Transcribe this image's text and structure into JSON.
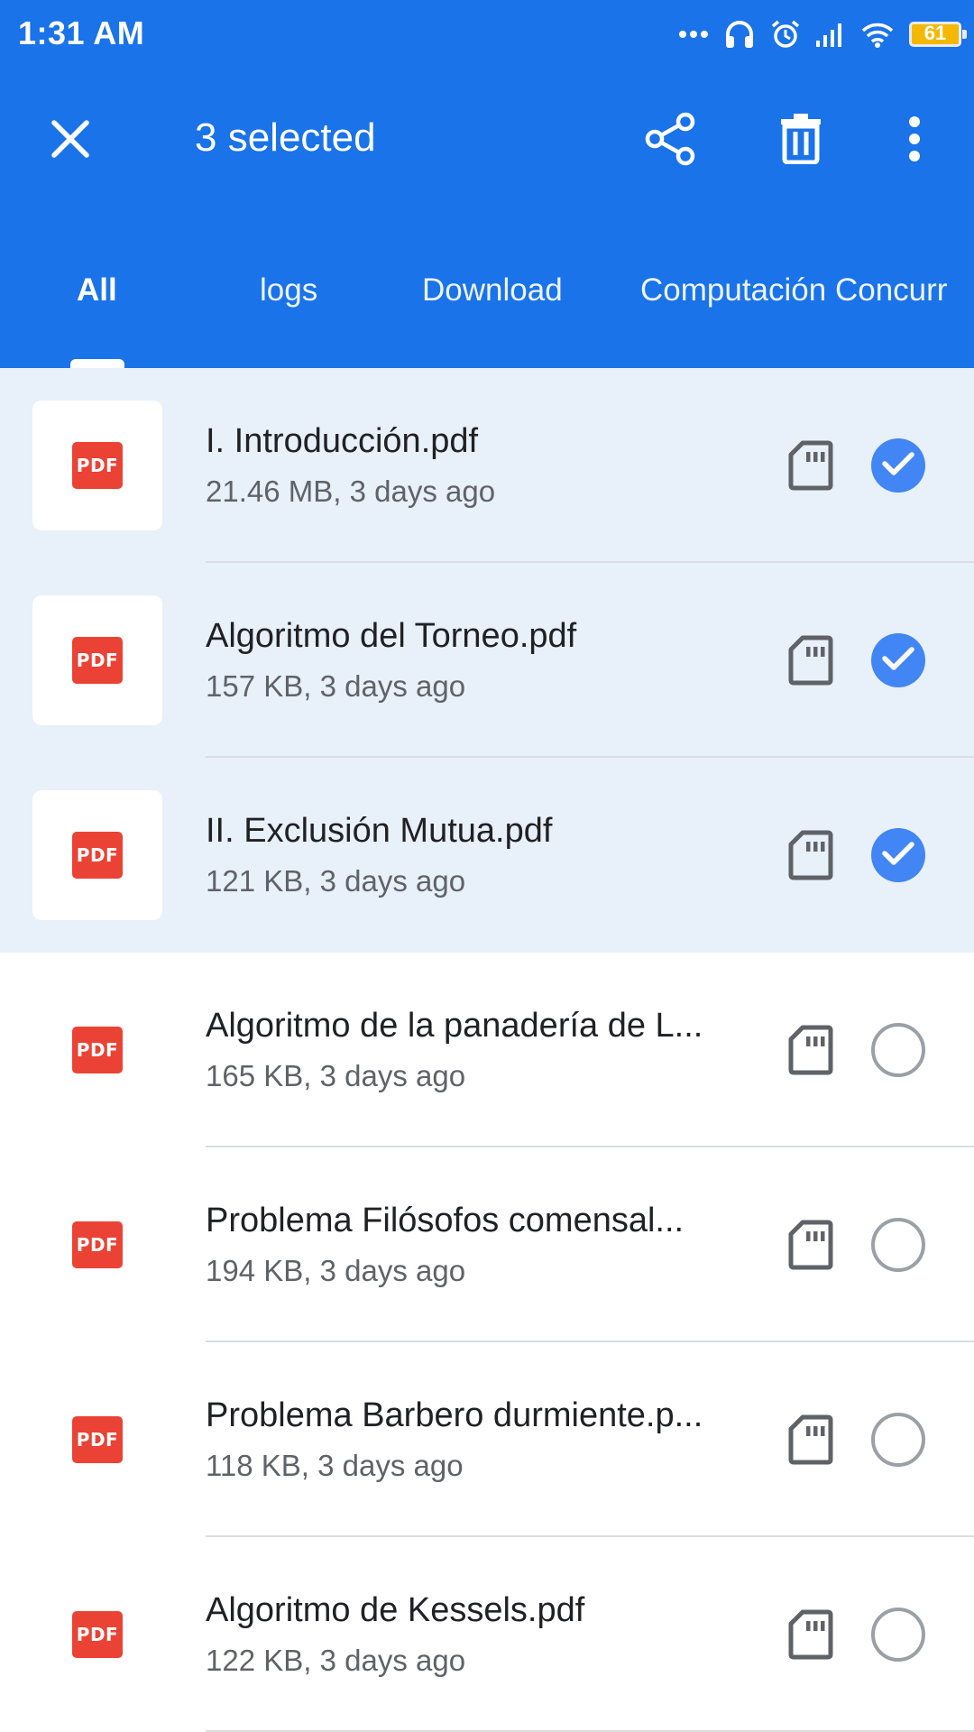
{
  "status_bar": {
    "time": "1:31 AM",
    "battery_level": "61",
    "icons": [
      "dots-icon",
      "headphones-icon",
      "alarm-icon",
      "signal-icon",
      "wifi-icon",
      "battery-icon"
    ]
  },
  "toolbar": {
    "title": "3 selected",
    "close_icon": "close-icon",
    "share_icon": "share-icon",
    "delete_icon": "delete-icon",
    "more_icon": "more-vert-icon"
  },
  "tabs": [
    {
      "label": "All",
      "active": true
    },
    {
      "label": "logs",
      "active": false
    },
    {
      "label": "Download",
      "active": false
    },
    {
      "label": "Computación Concurr",
      "active": false
    }
  ],
  "files": [
    {
      "name": "I. Introducción.pdf",
      "meta": "21.46 MB, 3 days ago",
      "selected": true,
      "type_badge": "PDF"
    },
    {
      "name": "Algoritmo del Torneo.pdf",
      "meta": "157 KB, 3 days ago",
      "selected": true,
      "type_badge": "PDF"
    },
    {
      "name": "II. Exclusión Mutua.pdf",
      "meta": "121 KB, 3 days ago",
      "selected": true,
      "type_badge": "PDF"
    },
    {
      "name": "Algoritmo de la panadería de L...",
      "meta": "165 KB, 3 days ago",
      "selected": false,
      "type_badge": "PDF"
    },
    {
      "name": "Problema Filósofos comensal...",
      "meta": "194 KB, 3 days ago",
      "selected": false,
      "type_badge": "PDF"
    },
    {
      "name": "Problema Barbero durmiente.p...",
      "meta": "118 KB, 3 days ago",
      "selected": false,
      "type_badge": "PDF"
    },
    {
      "name": "Algoritmo de Kessels.pdf",
      "meta": "122 KB, 3 days ago",
      "selected": false,
      "type_badge": "PDF"
    }
  ],
  "colors": {
    "app_bar": "#1a73e8",
    "selected_row": "#e8f0fa",
    "check_on": "#4285f4",
    "pdf_badge": "#ea4335"
  }
}
